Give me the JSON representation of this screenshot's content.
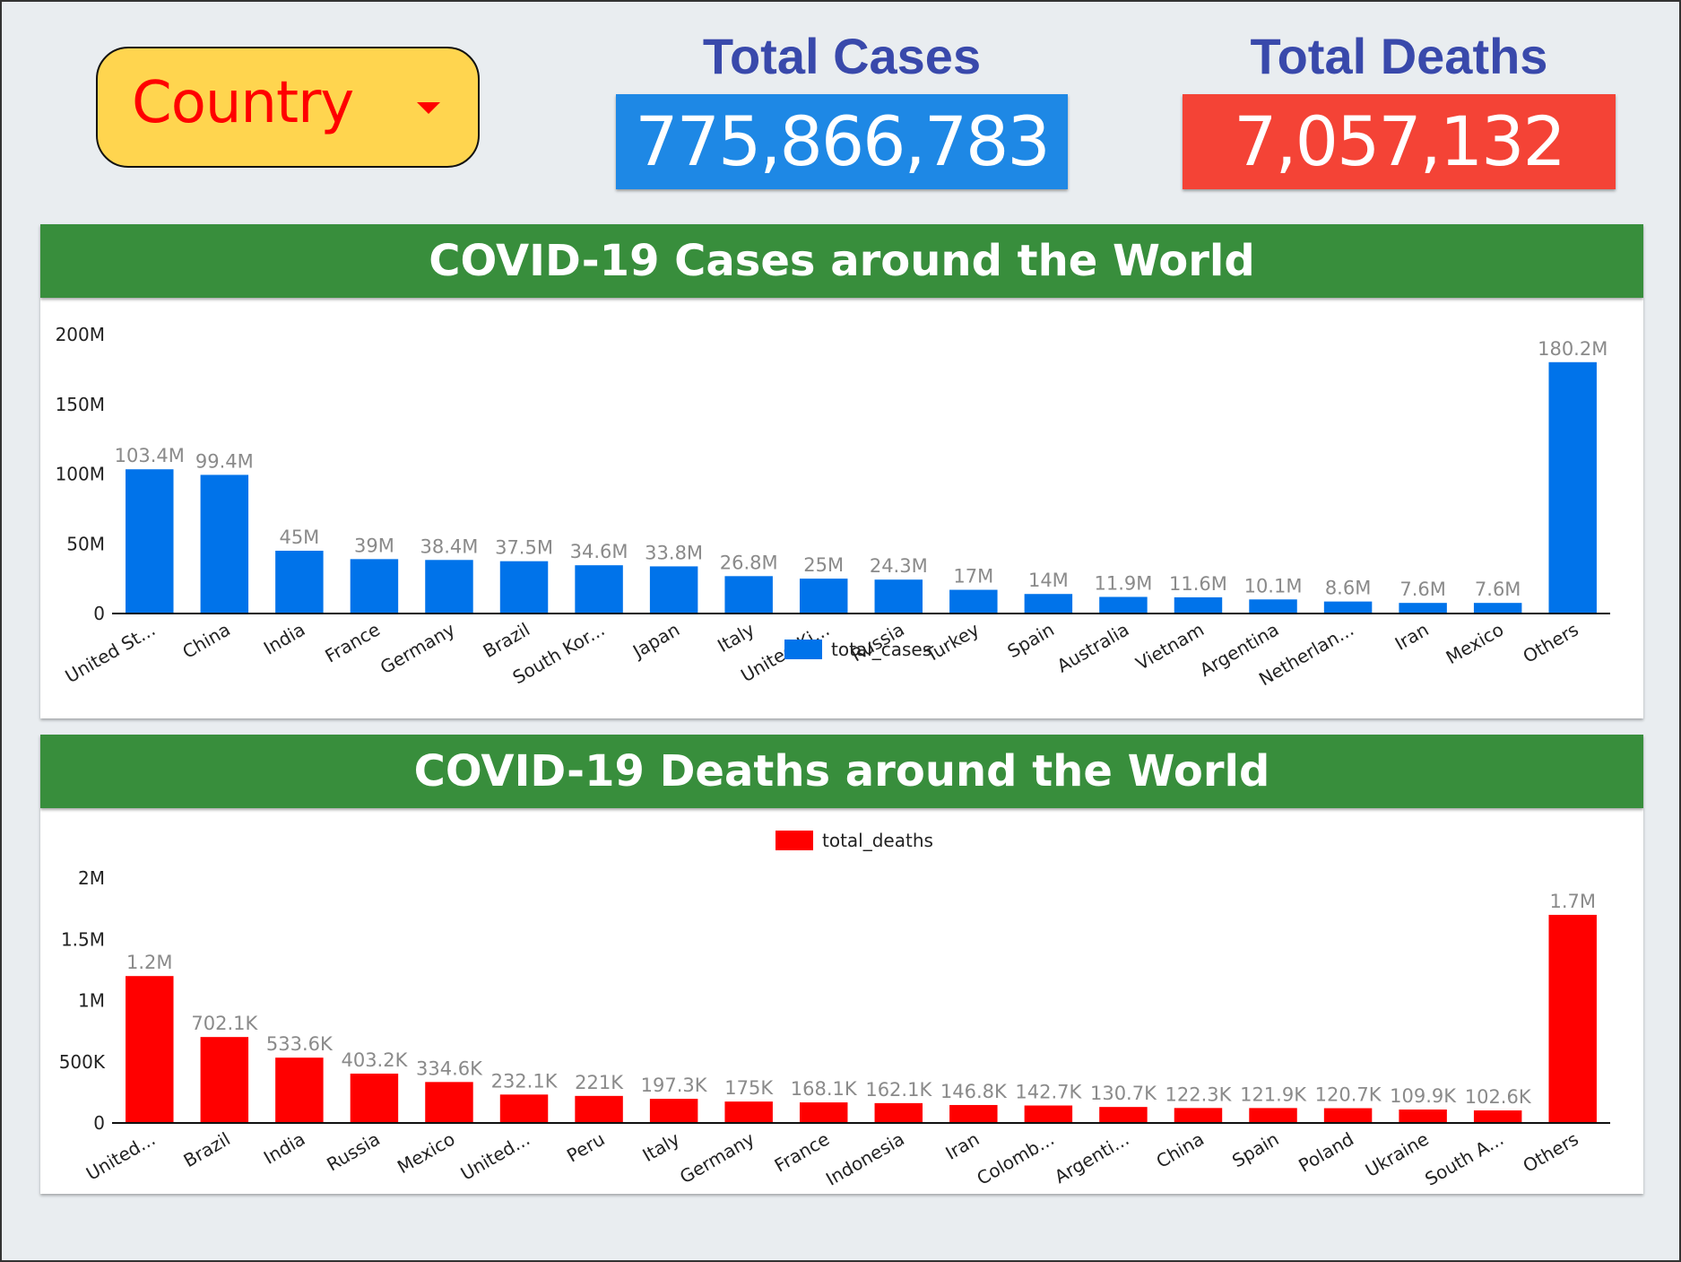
{
  "filter": {
    "label": "Country",
    "icon": "caret-down-icon"
  },
  "kpis": {
    "total_cases": {
      "title": "Total Cases",
      "value": "775,866,783",
      "color": "#1e88e5"
    },
    "total_deaths": {
      "title": "Total Deaths",
      "value": "7,057,132",
      "color": "#f44336"
    }
  },
  "sections": {
    "cases_title": "COVID-19 Cases around the World",
    "deaths_title": "COVID-19 Deaths around the World"
  },
  "chart_data": [
    {
      "type": "bar",
      "title": "COVID-19 Cases around the World",
      "xlabel": "",
      "ylabel": "",
      "ylim": [
        0,
        200000000
      ],
      "yticks": [
        0,
        50000000,
        100000000,
        150000000,
        200000000
      ],
      "ytick_labels": [
        "0",
        "50M",
        "100M",
        "150M",
        "200M"
      ],
      "grid": false,
      "legend": {
        "position": "bottom",
        "entries": [
          {
            "name": "total_cases",
            "color": "#0073ea"
          }
        ]
      },
      "categories": [
        "United St...",
        "China",
        "India",
        "France",
        "Germany",
        "Brazil",
        "South Kor...",
        "Japan",
        "Italy",
        "United Ki...",
        "Russia",
        "Turkey",
        "Spain",
        "Australia",
        "Vietnam",
        "Argentina",
        "Netherlan...",
        "Iran",
        "Mexico",
        "Others"
      ],
      "series": [
        {
          "name": "total_cases",
          "color": "#0073ea",
          "values": [
            103400000,
            99400000,
            45000000,
            39000000,
            38400000,
            37500000,
            34600000,
            33800000,
            26800000,
            25000000,
            24300000,
            17000000,
            14000000,
            11900000,
            11600000,
            10100000,
            8600000,
            7600000,
            7600000,
            180200000
          ],
          "labels": [
            "103.4M",
            "99.4M",
            "45M",
            "39M",
            "38.4M",
            "37.5M",
            "34.6M",
            "33.8M",
            "26.8M",
            "25M",
            "24.3M",
            "17M",
            "14M",
            "11.9M",
            "11.6M",
            "10.1M",
            "8.6M",
            "7.6M",
            "7.6M",
            "180.2M"
          ]
        }
      ]
    },
    {
      "type": "bar",
      "title": "COVID-19 Deaths around the World",
      "xlabel": "",
      "ylabel": "",
      "ylim": [
        0,
        2000000
      ],
      "yticks": [
        0,
        500000,
        1000000,
        1500000,
        2000000
      ],
      "ytick_labels": [
        "0",
        "500K",
        "1M",
        "1.5M",
        "2M"
      ],
      "grid": false,
      "legend": {
        "position": "top",
        "entries": [
          {
            "name": "total_deaths",
            "color": "#ff0000"
          }
        ]
      },
      "categories": [
        "United...",
        "Brazil",
        "India",
        "Russia",
        "Mexico",
        "United...",
        "Peru",
        "Italy",
        "Germany",
        "France",
        "Indonesia",
        "Iran",
        "Colomb...",
        "Argenti...",
        "China",
        "Spain",
        "Poland",
        "Ukraine",
        "South A...",
        "Others"
      ],
      "series": [
        {
          "name": "total_deaths",
          "color": "#ff0000",
          "values": [
            1200000,
            702100,
            533600,
            403200,
            334600,
            232100,
            221000,
            197300,
            175000,
            168100,
            162100,
            146800,
            142700,
            130700,
            122300,
            121900,
            120700,
            109900,
            102600,
            1700000
          ],
          "labels": [
            "1.2M",
            "702.1K",
            "533.6K",
            "403.2K",
            "334.6K",
            "232.1K",
            "221K",
            "197.3K",
            "175K",
            "168.1K",
            "162.1K",
            "146.8K",
            "142.7K",
            "130.7K",
            "122.3K",
            "121.9K",
            "120.7K",
            "109.9K",
            "102.6K",
            "1.7M"
          ]
        }
      ]
    }
  ]
}
